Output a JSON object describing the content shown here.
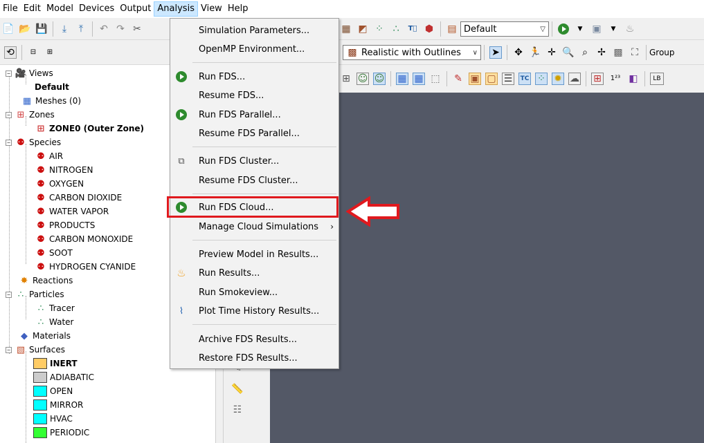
{
  "menubar": [
    "File",
    "Edit",
    "Model",
    "Devices",
    "Output",
    "Analysis",
    "View",
    "Help"
  ],
  "toolbar": {
    "view_combo": "Default",
    "render_combo": "Realistic with Outlines",
    "group_label": "Group",
    "label_123": "1²³",
    "label_lb": "LB"
  },
  "tree": {
    "views": "Views",
    "views_default": "Default",
    "meshes": "Meshes (0)",
    "zones": "Zones",
    "zone0": "ZONE0 (Outer Zone)",
    "species": "Species",
    "species_items": [
      "AIR",
      "NITROGEN",
      "OXYGEN",
      "CARBON DIOXIDE",
      "WATER VAPOR",
      "PRODUCTS",
      "CARBON MONOXIDE",
      "SOOT",
      "HYDROGEN CYANIDE"
    ],
    "reactions": "Reactions",
    "particles": "Particles",
    "particle_items": [
      "Tracer",
      "Water"
    ],
    "materials": "Materials",
    "surfaces": "Surfaces",
    "surface_items": [
      {
        "label": "INERT",
        "color": "#ffcc66"
      },
      {
        "label": "ADIABATIC",
        "color": "#cccccc"
      },
      {
        "label": "OPEN",
        "color": "#00ffff"
      },
      {
        "label": "MIRROR",
        "color": "#00ffff"
      },
      {
        "label": "HVAC",
        "color": "#00ffff"
      },
      {
        "label": "PERIODIC",
        "color": "#33ff33"
      }
    ]
  },
  "analysis_menu": {
    "items": [
      "Simulation Parameters...",
      "OpenMP Environment...",
      "Run FDS...",
      "Resume FDS...",
      "Run FDS Parallel...",
      "Resume FDS Parallel...",
      "Run FDS Cluster...",
      "Resume FDS Cluster...",
      "Run FDS Cloud...",
      "Manage Cloud Simulations",
      "Preview Model in Results...",
      "Run Results...",
      "Run Smokeview...",
      "Plot Time History Results...",
      "Archive FDS Results...",
      "Restore FDS Results..."
    ],
    "submenu_arrow": "›"
  },
  "colors": {
    "highlight": "#e0191e",
    "viewport": "#535866",
    "run_green": "#2e8b2e"
  }
}
